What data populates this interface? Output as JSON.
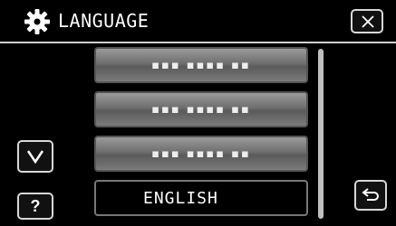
{
  "header": {
    "title": "LANGUAGE",
    "settings_icon": "gear-icon",
    "close_icon": "close-icon"
  },
  "language_list": {
    "items": [
      {
        "label": "▪▪▪ ▪▪▪▪ ▪▪",
        "selected": false
      },
      {
        "label": "▪▪▪ ▪▪▪▪ ▪▪",
        "selected": false
      },
      {
        "label": "▪▪▪ ▪▪▪▪ ▪▪",
        "selected": false
      },
      {
        "label": "ENGLISH",
        "selected": true
      }
    ]
  },
  "controls": {
    "down_icon": "chevron-down-icon",
    "help_label": "?",
    "back_icon": "return-icon"
  }
}
